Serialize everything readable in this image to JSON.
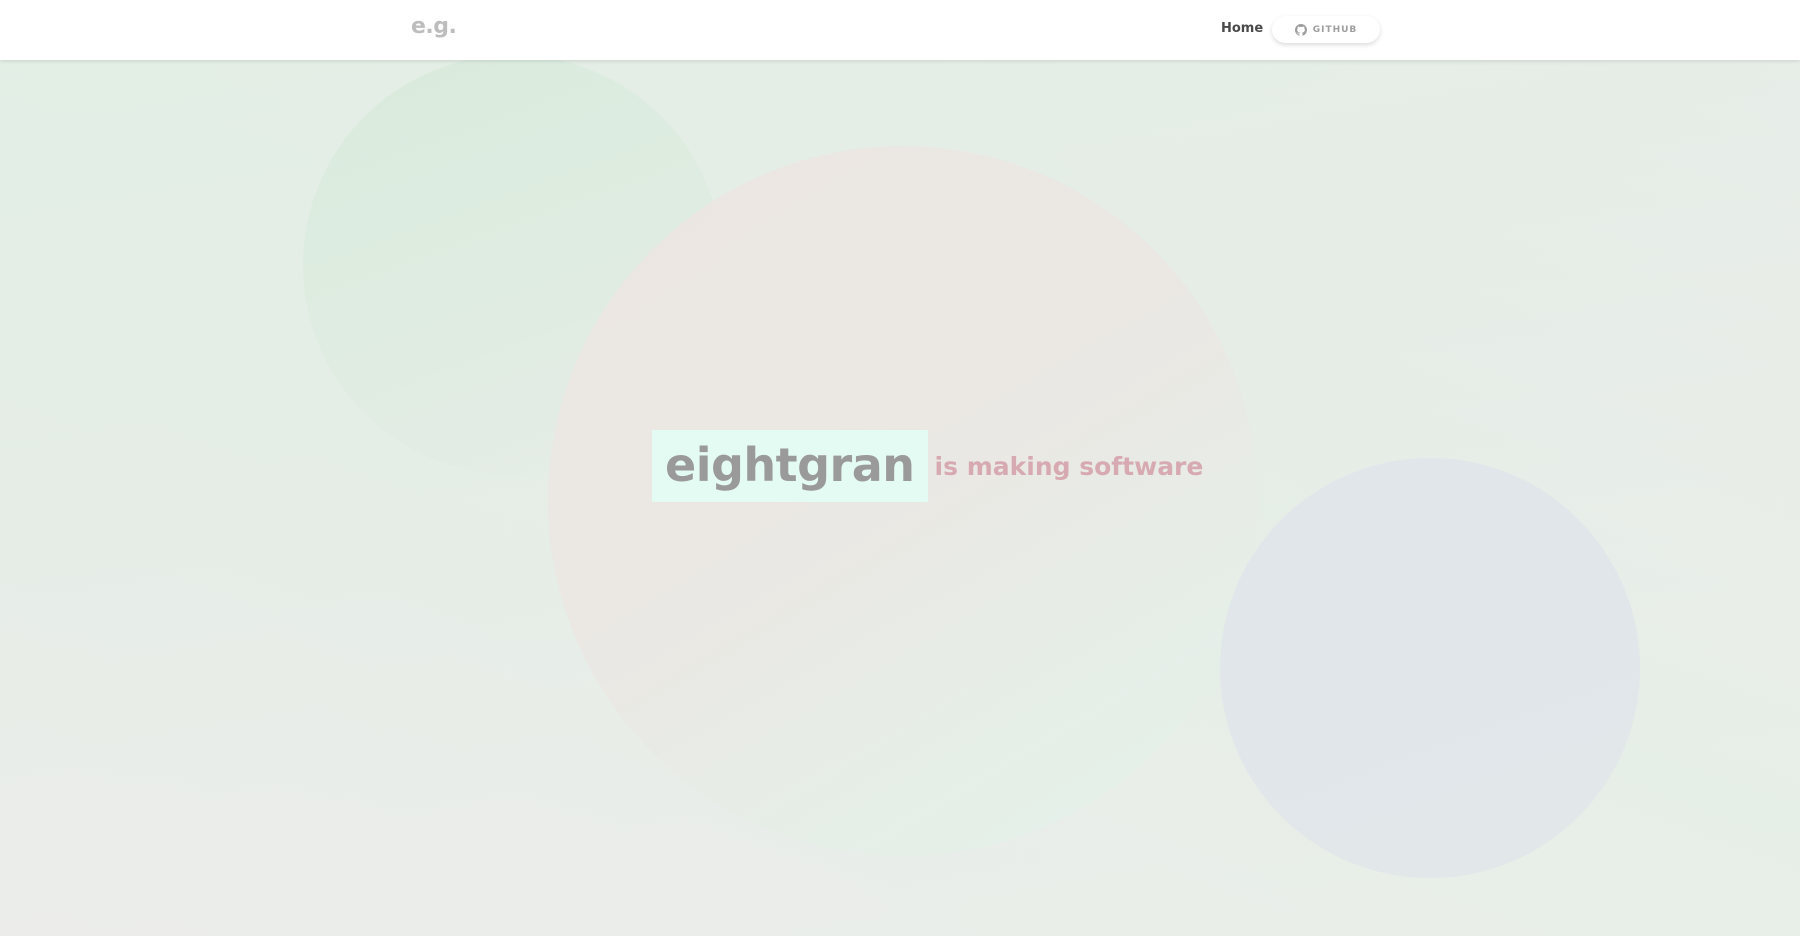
{
  "header": {
    "logo": "e.g.",
    "nav": {
      "home_label": "Home",
      "github_label": "GITHUB",
      "github_icon": "github-icon"
    }
  },
  "hero": {
    "brand": "eightgran",
    "tagline": "is making software"
  },
  "colors": {
    "brand_box_bg": "#e4fbf4",
    "brand_text": "#9a9a9a",
    "tagline_text": "#d7a9b1",
    "logo_text": "#bdbdbd"
  }
}
